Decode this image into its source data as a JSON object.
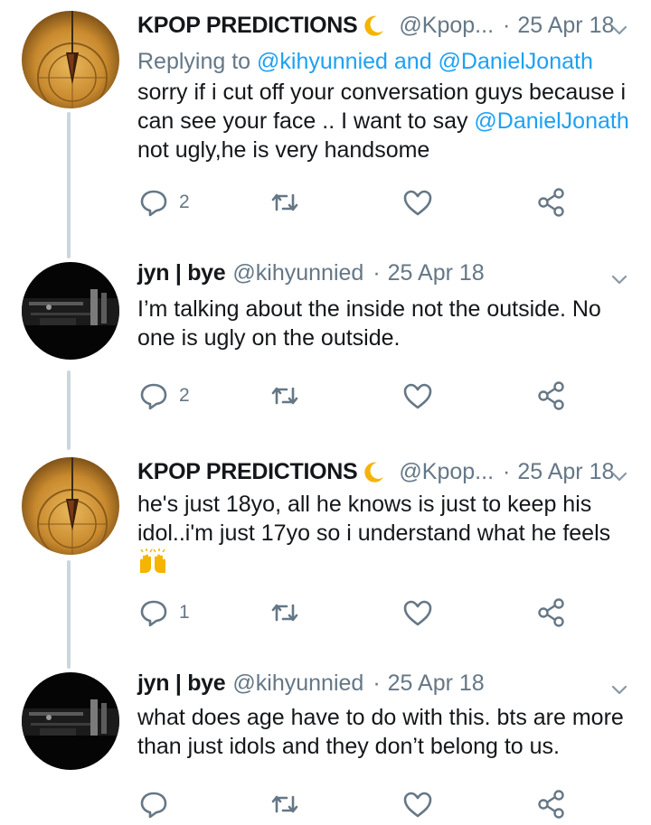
{
  "tweets": [
    {
      "name": "KPOP PREDICTIONS",
      "name_emoji": "crescent-moon-icon",
      "handle": "@Kpop...",
      "dot": "·",
      "date": "25 Apr 18",
      "reply_prefix": "Replying to",
      "reply_mentions": "@kihyunnied and @DanielJonath",
      "text_parts": [
        "sorry if i cut off your conversation guys because i can see your face .. I want to say ",
        "@DanielJonath",
        " not ugly,he is very handsome"
      ],
      "reply_count": "2",
      "avatar": "pendulum-on-dial-avatar"
    },
    {
      "name": "jyn | bye",
      "handle": "@kihyunnied",
      "dot": "·",
      "date": "25 Apr 18",
      "text": "I’m talking about the inside not the outside. No one is ugly on the outside.",
      "reply_count": "2",
      "avatar": "dark-night-street-avatar"
    },
    {
      "name": "KPOP PREDICTIONS",
      "name_emoji": "crescent-moon-icon",
      "handle": "@Kpop...",
      "dot": "·",
      "date": "25 Apr 18",
      "text": "he's just 18yo, all he knows is just to keep his idol..i'm just 17yo so i understand what he feels",
      "text_emoji": "raising-hands-icon",
      "reply_count": "1",
      "avatar": "pendulum-on-dial-avatar"
    },
    {
      "name": "jyn | bye",
      "handle": "@kihyunnied",
      "dot": "·",
      "date": "25 Apr 18",
      "text": "what does age have to do with this. bts are more than just idols and they don’t belong to us.",
      "reply_count": "",
      "avatar": "dark-night-street-avatar"
    }
  ],
  "colors": {
    "link": "#1da1f2",
    "muted": "#657786",
    "thread": "#ccd6dd"
  }
}
